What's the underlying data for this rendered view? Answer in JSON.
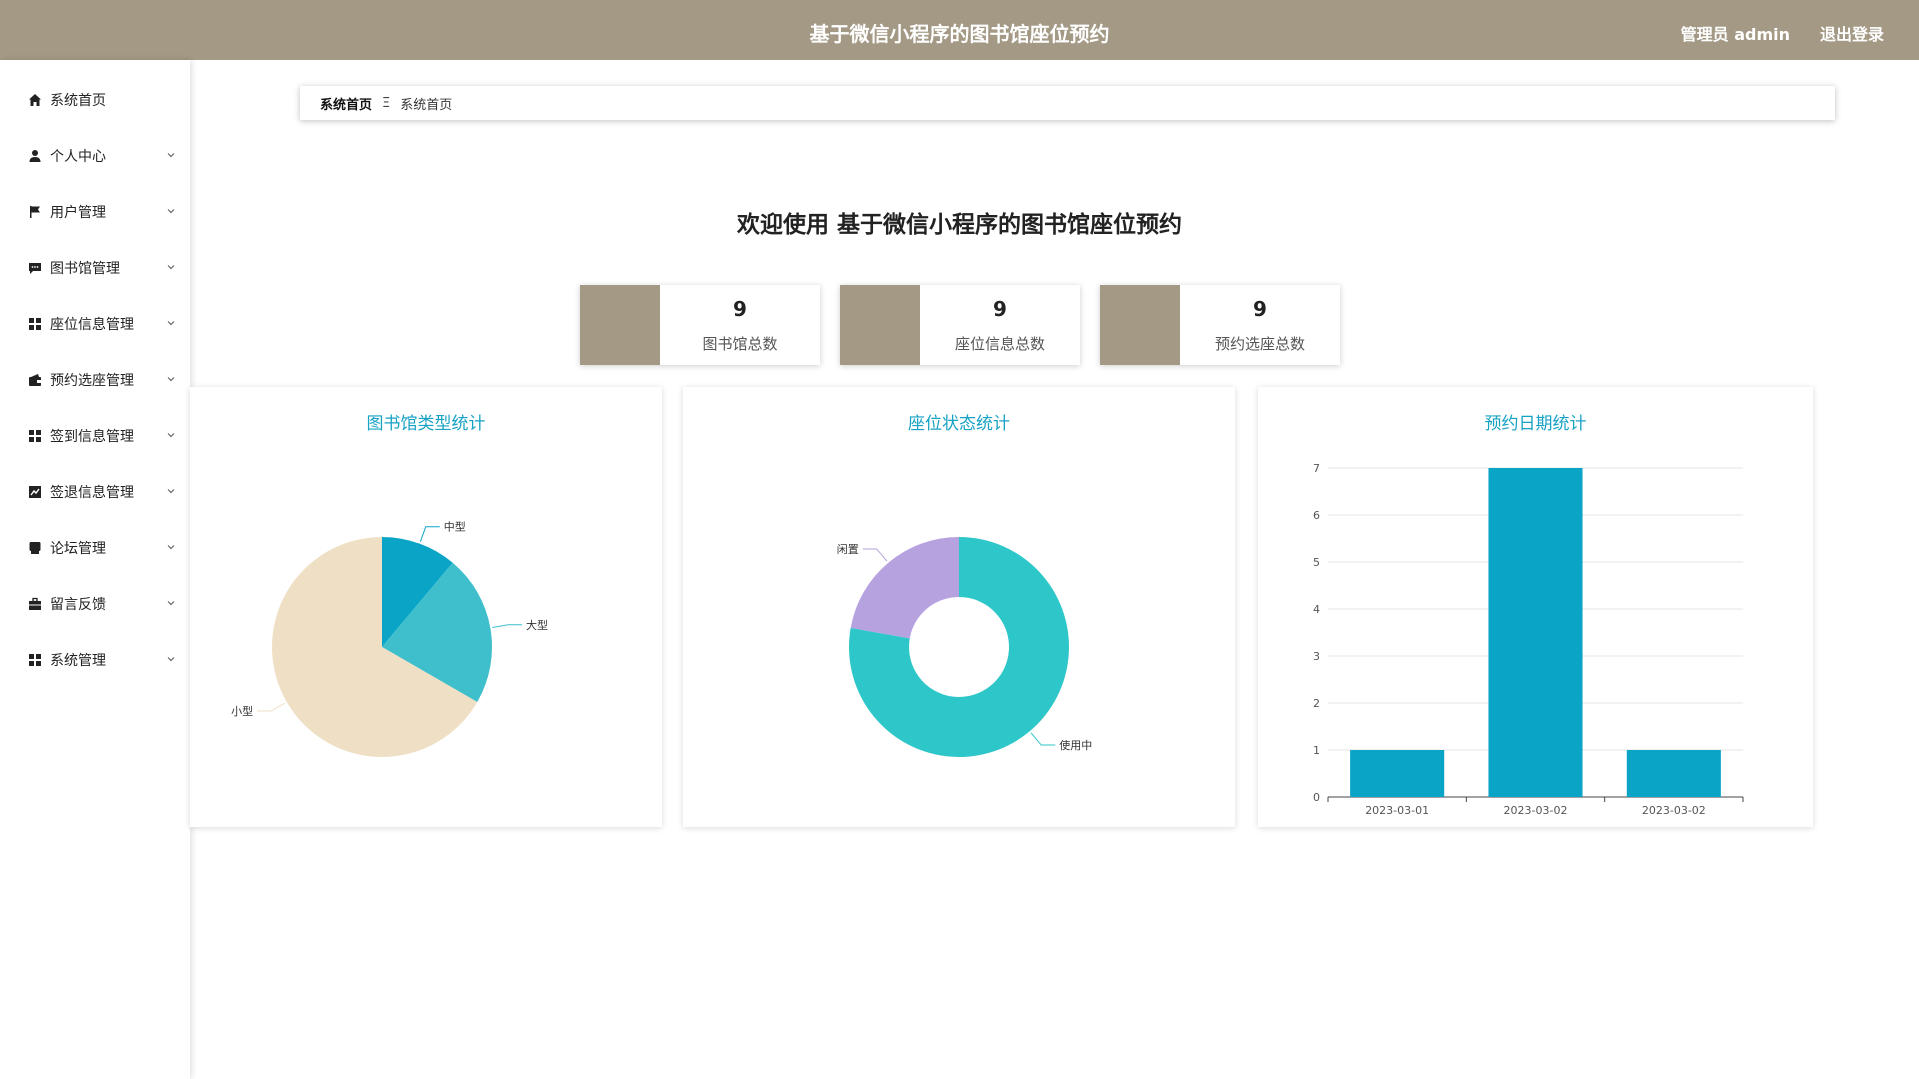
{
  "header": {
    "title": "基于微信小程序的图书馆座位预约",
    "user": "管理员 admin",
    "logout": "退出登录"
  },
  "sidebar": {
    "items": [
      {
        "label": "系统首页",
        "icon": "home-icon",
        "has_children": false
      },
      {
        "label": "个人中心",
        "icon": "user-icon",
        "has_children": true
      },
      {
        "label": "用户管理",
        "icon": "flag-icon",
        "has_children": true
      },
      {
        "label": "图书馆管理",
        "icon": "chat-icon",
        "has_children": true
      },
      {
        "label": "座位信息管理",
        "icon": "grid-icon",
        "has_children": true
      },
      {
        "label": "预约选座管理",
        "icon": "wallet-icon",
        "has_children": true
      },
      {
        "label": "签到信息管理",
        "icon": "grid-icon",
        "has_children": true
      },
      {
        "label": "签退信息管理",
        "icon": "chart-icon",
        "has_children": true
      },
      {
        "label": "论坛管理",
        "icon": "message-icon",
        "has_children": true
      },
      {
        "label": "留言反馈",
        "icon": "briefcase-icon",
        "has_children": true
      },
      {
        "label": "系统管理",
        "icon": "grid-icon",
        "has_children": true
      }
    ]
  },
  "breadcrumb": {
    "root": "系统首页",
    "separator": "Ξ",
    "current": "系统首页"
  },
  "welcome": "欢迎使用 基于微信小程序的图书馆座位预约",
  "stats": [
    {
      "value": "9",
      "label": "图书馆总数"
    },
    {
      "value": "9",
      "label": "座位信息总数"
    },
    {
      "value": "9",
      "label": "预约选座总数"
    }
  ],
  "colors": {
    "accent": "#a39985",
    "chart_title": "#17a2c4"
  },
  "chart_data": [
    {
      "type": "pie",
      "title": "图书馆类型统计",
      "slices": [
        {
          "label": "中型",
          "value": 1,
          "color": "#0aa5c6"
        },
        {
          "label": "大型",
          "value": 2,
          "color": "#3ebfcb"
        },
        {
          "label": "小型",
          "value": 6,
          "color": "#efdfc4"
        }
      ]
    },
    {
      "type": "pie",
      "title": "座位状态统计",
      "donut": true,
      "slices": [
        {
          "label": "使用中",
          "value": 7,
          "color": "#2ec7c9"
        },
        {
          "label": "闲置",
          "value": 2,
          "color": "#b6a2de"
        }
      ]
    },
    {
      "type": "bar",
      "title": "预约日期统计",
      "categories": [
        "2023-03-01",
        "2023-03-02",
        "2023-03-02"
      ],
      "values": [
        1,
        7,
        1
      ],
      "ylim": [
        0,
        7
      ],
      "yticks": [
        0,
        1,
        2,
        3,
        4,
        5,
        6,
        7
      ],
      "grid": true,
      "color": "#0aa5c6"
    }
  ]
}
